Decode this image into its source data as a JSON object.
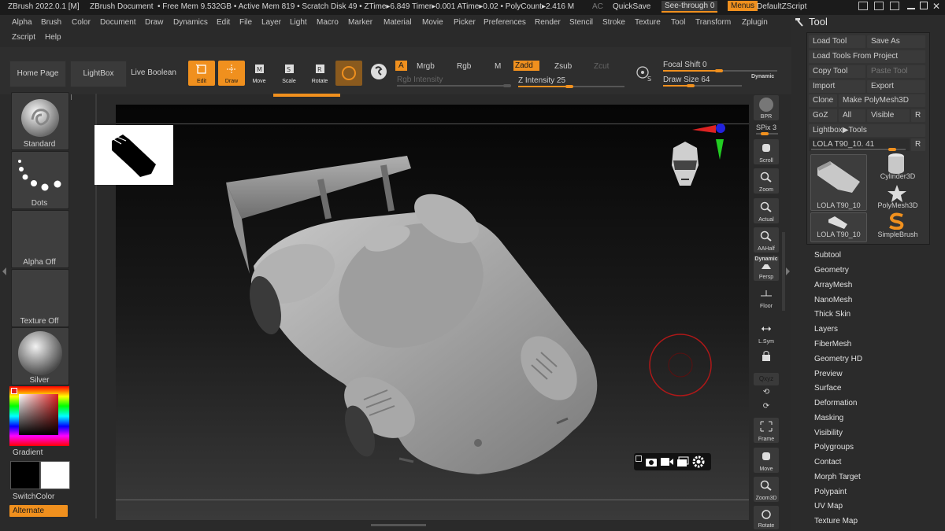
{
  "statusbar": {
    "app_title": "ZBrush 2022.0.1 [M]",
    "document": "ZBrush Document",
    "mem_info": "• Free Mem 9.532GB • Active Mem 819 • Scratch Disk 49 • ZTime▸6.849 Timer▸0.001 ATime▸0.02 • PolyCount▸2.416 M",
    "ac": "AC",
    "quicksave": "QuickSave",
    "seethrough": "See-through  0",
    "menus": "Menus",
    "zscript": "DefaultZScript"
  },
  "menu": {
    "row1": [
      "Alpha",
      "Brush",
      "Color",
      "Document",
      "Draw",
      "Dynamics",
      "Edit",
      "File",
      "Layer",
      "Light",
      "Macro",
      "Marker",
      "Material",
      "Movie",
      "Picker",
      "Preferences",
      "Render",
      "Stencil",
      "Stroke",
      "Texture",
      "Tool",
      "Transform",
      "Zplugin"
    ],
    "row2": [
      "Zscript",
      "Help"
    ]
  },
  "shelf": {
    "home_page": "Home Page",
    "lightbox": "LightBox",
    "live_boolean": "Live Boolean",
    "edit": "Edit",
    "draw": "Draw",
    "move": "Move",
    "scale": "Scale",
    "rotate": "Rotate",
    "a": "A",
    "mrgb": "Mrgb",
    "rgb": "Rgb",
    "m": "M",
    "zadd": "Zadd",
    "zsub": "Zsub",
    "zcut": "Zcut",
    "rgb_intensity": "Rgb Intensity",
    "z_intensity_label": "Z Intensity",
    "z_intensity_value": "25",
    "focal_shift_label": "Focal Shift",
    "focal_shift_value": "0",
    "draw_size_label": "Draw Size",
    "draw_size_value": "64",
    "dynamic": "Dynamic"
  },
  "left": {
    "brush": "Standard",
    "stroke": "Dots",
    "alpha": "Alpha Off",
    "texture": "Texture Off",
    "material": "Silver",
    "gradient": "Gradient",
    "switchcolor": "SwitchColor",
    "alternate": "Alternate"
  },
  "right_tray": {
    "bpr": "BPR",
    "spix_label": "SPix",
    "spix_value": "3",
    "scroll": "Scroll",
    "zoom": "Zoom",
    "actual": "Actual",
    "aahalf": "AAHalf",
    "dynamic": "Dynamic",
    "persp": "Persp",
    "floor": "Floor",
    "lsym": "L.Sym",
    "xyz": "Qxyz",
    "frame": "Frame",
    "move": "Move",
    "zoom3d": "Zoom3D",
    "rotate": "Rotate"
  },
  "tool": {
    "title": "Tool",
    "load_tool": "Load Tool",
    "save_as": "Save As",
    "load_from_project": "Load Tools From Project",
    "copy_tool": "Copy Tool",
    "paste_tool": "Paste Tool",
    "import": "Import",
    "export": "Export",
    "clone": "Clone",
    "make_polymesh": "Make PolyMesh3D",
    "goz": "GoZ",
    "all": "All",
    "visible": "Visible",
    "r": "R",
    "lightbox_tools": "Lightbox▶Tools",
    "current_tool_label": "LOLA T90_10. 41",
    "current_r": "R",
    "thumbs": [
      "LOLA T90_10",
      "Cylinder3D",
      "PolyMesh3D",
      "LOLA T90_10",
      "SimpleBrush"
    ],
    "sections": [
      "Subtool",
      "Geometry",
      "ArrayMesh",
      "NanoMesh",
      "Thick Skin",
      "Layers",
      "FiberMesh",
      "Geometry HD",
      "Preview",
      "Surface",
      "Deformation",
      "Masking",
      "Visibility",
      "Polygroups",
      "Contact",
      "Morph Target",
      "Polypaint",
      "UV Map",
      "Texture Map"
    ]
  },
  "colors": {
    "accent": "#f0901e",
    "panel": "#2b2b2b",
    "button": "#3a3a3a"
  }
}
